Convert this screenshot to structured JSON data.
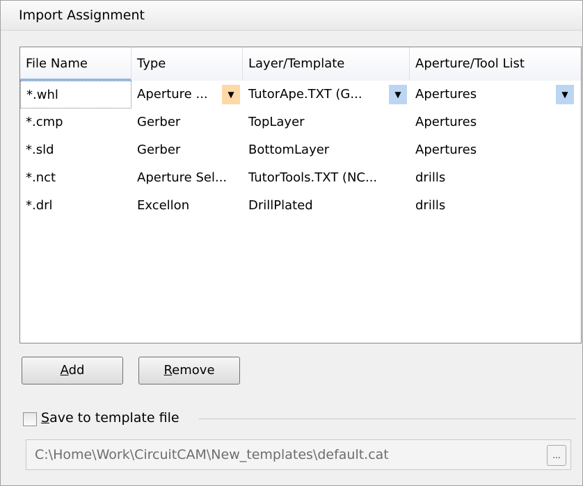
{
  "panel": {
    "title": "Import Assignment"
  },
  "table": {
    "columns": [
      "File Name",
      "Type",
      "Layer/Template",
      "Aperture/Tool List"
    ],
    "rows": [
      {
        "file": "*.whl",
        "type": "Aperture ...",
        "layer": "TutorApe.TXT (G...",
        "list": "Apertures"
      },
      {
        "file": "*.cmp",
        "type": "Gerber",
        "layer": "TopLayer",
        "list": "Apertures"
      },
      {
        "file": "*.sld",
        "type": "Gerber",
        "layer": "BottomLayer",
        "list": "Apertures"
      },
      {
        "file": "*.nct",
        "type": "Aperture Sel...",
        "layer": "TutorTools.TXT (NC...",
        "list": "drills"
      },
      {
        "file": "*.drl",
        "type": "Excellon",
        "layer": "DrillPlated",
        "list": "drills"
      }
    ]
  },
  "buttons": {
    "add_prefix": "",
    "add_mnemonic": "A",
    "add_rest": "dd",
    "remove_prefix": "",
    "remove_mnemonic": "R",
    "remove_rest": "emove",
    "browse_label": "..."
  },
  "save_template": {
    "checked": false,
    "label_mnemonic": "S",
    "label_rest": "ave to template file",
    "path": "C:\\Home\\Work\\CircuitCAM\\New_templates\\default.cat"
  },
  "icons": {
    "dropdown": "chevron-down-icon"
  },
  "colors": {
    "header_accent": "#8fb8e8",
    "combo_button": "#bcd5f2",
    "combo_button_hot": "#ffd8a8"
  }
}
